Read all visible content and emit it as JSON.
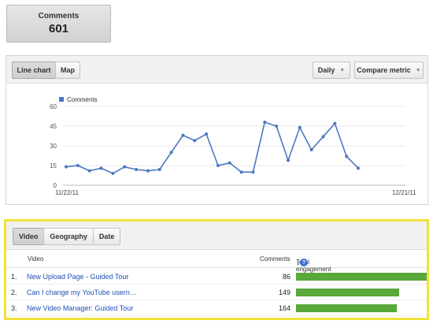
{
  "metric_card": {
    "label": "Comments",
    "value": "601"
  },
  "chart_toolbar": {
    "view_buttons": [
      "Line chart",
      "Map"
    ],
    "period_dropdown": "Daily",
    "compare_dropdown": "Compare metric"
  },
  "chart_data": {
    "type": "line",
    "series": [
      {
        "name": "Comments",
        "color": "#4a78c2",
        "values": [
          14,
          15,
          11,
          13,
          9,
          14,
          12,
          11,
          12,
          25,
          38,
          34,
          39,
          15,
          17,
          10,
          10,
          48,
          45,
          19,
          44,
          27,
          37,
          47,
          22,
          13
        ]
      }
    ],
    "x_tick_labels": [
      "11/22/11",
      "12/21/11"
    ],
    "y_ticks": [
      0,
      15,
      30,
      45,
      60
    ],
    "ylim": [
      0,
      60
    ],
    "grid": true,
    "legend_position": "top-left"
  },
  "table": {
    "tabs": [
      "Video",
      "Geography",
      "Date"
    ],
    "headers": {
      "video": "Video",
      "comments": "Comments",
      "engagement": "Total engagement"
    },
    "rows": [
      {
        "num": "1.",
        "title": "New Upload Page - Guided Tour",
        "comments": "86",
        "engagement": 1.0
      },
      {
        "num": "2.",
        "title": "Can I change my YouTube usern…",
        "comments": "149",
        "engagement": 0.79
      },
      {
        "num": "3.",
        "title": "New Video Manager: Guided Tour",
        "comments": "164",
        "engagement": 0.77
      }
    ],
    "bar_color": "#58a83a"
  }
}
